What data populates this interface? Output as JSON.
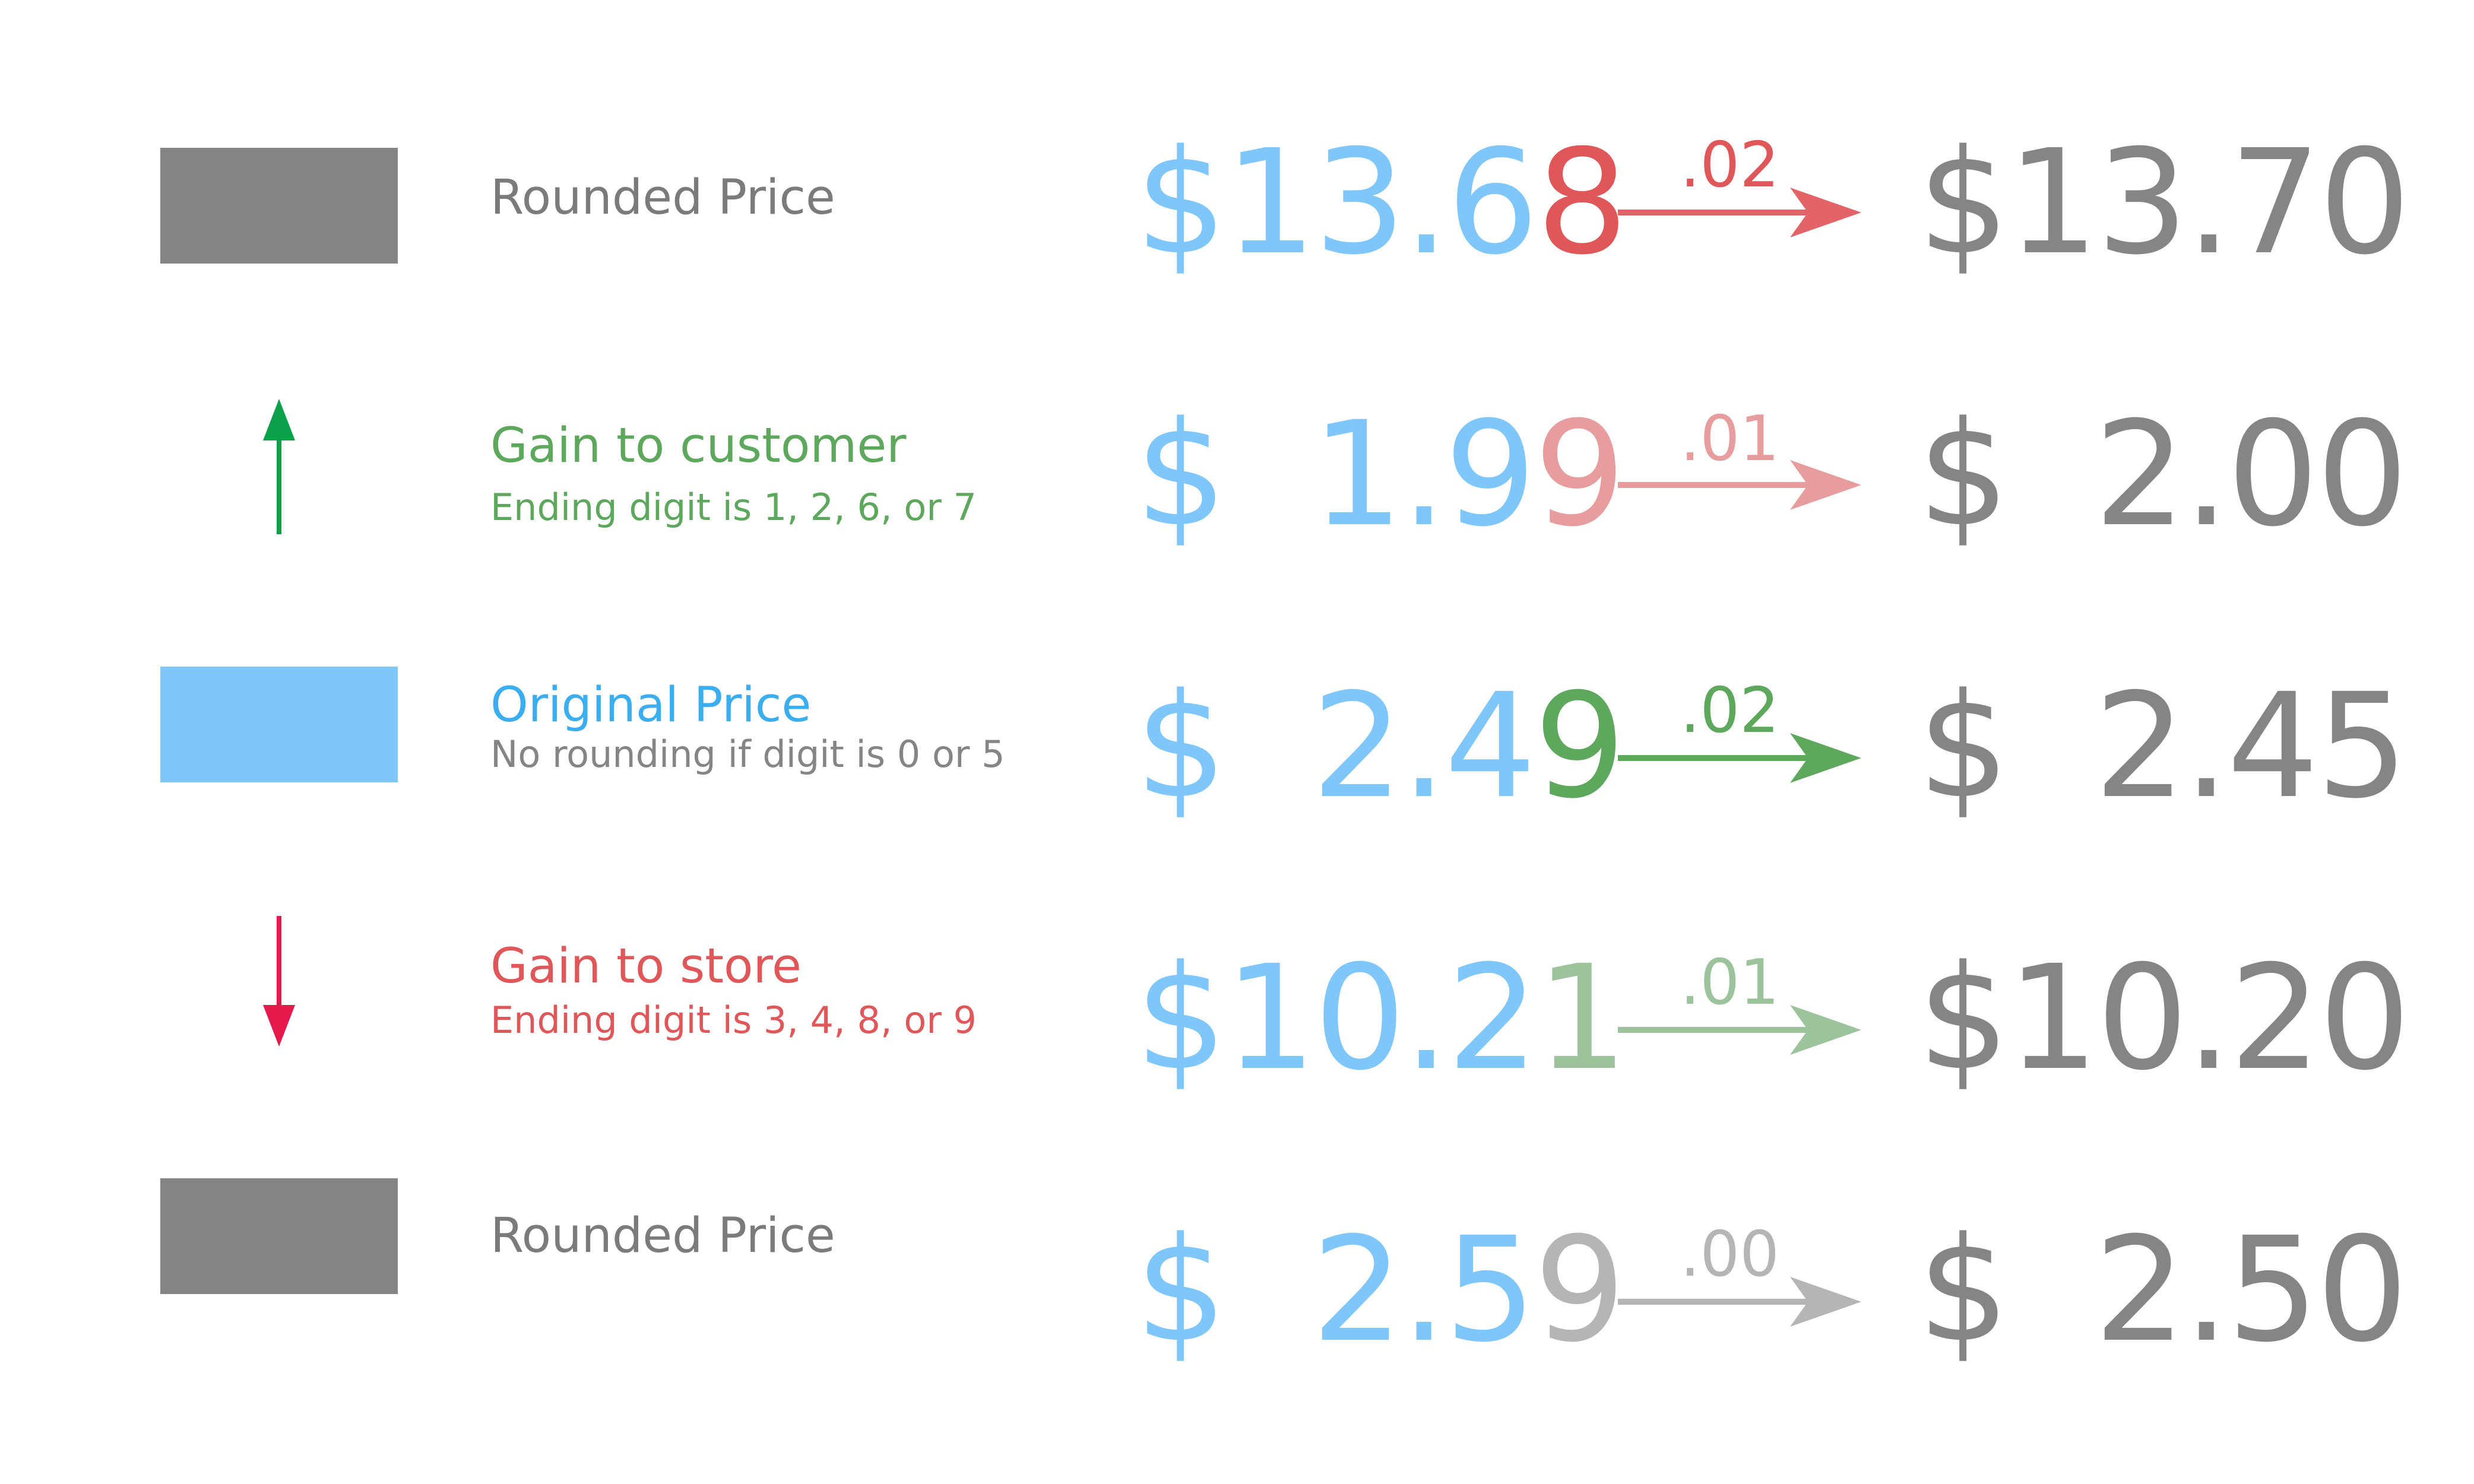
{
  "legend": {
    "rounded_top": {
      "title": "Rounded Price",
      "swatch_color": "#848484",
      "title_color": "#7b7b7b"
    },
    "gain_customer": {
      "title": "Gain to customer",
      "subtitle": "Ending digit is 1, 2, 6, or 7",
      "icon": "up-arrow-icon",
      "color": "#5ea85e",
      "arrow_color": "#0aa04a"
    },
    "original": {
      "title": "Original Price",
      "subtitle": "No rounding if digit is 0 or 5",
      "swatch_color": "#7fc7fb",
      "title_color": "#3aaef0",
      "subtitle_color": "#858585"
    },
    "gain_store": {
      "title": "Gain to store",
      "subtitle": "Ending digit is 3, 4, 8, or 9",
      "icon": "down-arrow-icon",
      "color": "#e0575a",
      "arrow_color": "#e5194c"
    },
    "rounded_bottom": {
      "title": "Rounded Price",
      "swatch_color": "#848484",
      "title_color": "#7b7b7b"
    }
  },
  "rows": [
    {
      "original_leading": "$13.6",
      "original_last": "8",
      "last_color": "#e0575a",
      "difference": ".02",
      "arrow_color": "#e36468",
      "rounded": "$13.70"
    },
    {
      "original_leading": "$  1.9",
      "original_last": "9",
      "last_color": "#e79d9d",
      "difference": ".01",
      "arrow_color": "#e79d9d",
      "rounded": "$  2.00"
    },
    {
      "original_leading": "$  2.4",
      "original_last": "9",
      "last_color": "#5ea85e",
      "difference": ".02",
      "arrow_color": "#5ea85e",
      "rounded": "$  2.45"
    },
    {
      "original_leading": "$10.2",
      "original_last": "1",
      "last_color": "#9cc39c",
      "difference": ".01",
      "arrow_color": "#9cc39c",
      "rounded": "$10.20"
    },
    {
      "original_leading": "$  2.5",
      "original_last": "9",
      "last_color": "#b5b5b5",
      "difference": ".00",
      "arrow_color": "#b5b5b5",
      "rounded": "$  2.50"
    }
  ]
}
